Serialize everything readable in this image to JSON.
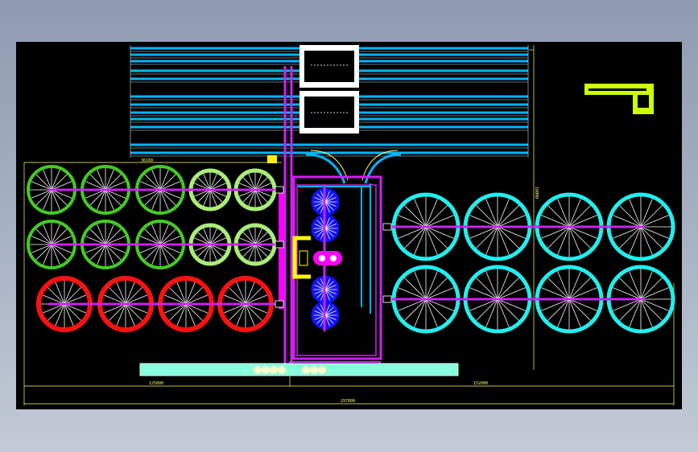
{
  "dimensions": {
    "top_left": "36160",
    "right_vertical": "18000",
    "bottom_left": "125000",
    "bottom_right": "152000",
    "overall": "297000"
  },
  "colors": {
    "background": "#000000",
    "pipe_cyan": "#00b4ff",
    "main_pipe": "#cc22ee",
    "dim_line": "#ffff66",
    "white": "#ffffff",
    "tank_green_dark": "#44cc22",
    "tank_green_light": "#aaee77",
    "tank_red": "#ff1111",
    "tank_cyan": "#22eeee",
    "tank_blue": "#1111ff",
    "label_yellow": "#ffff00",
    "legend_yellow_green": "#ccff00",
    "base_strip": "#88ffdd"
  }
}
